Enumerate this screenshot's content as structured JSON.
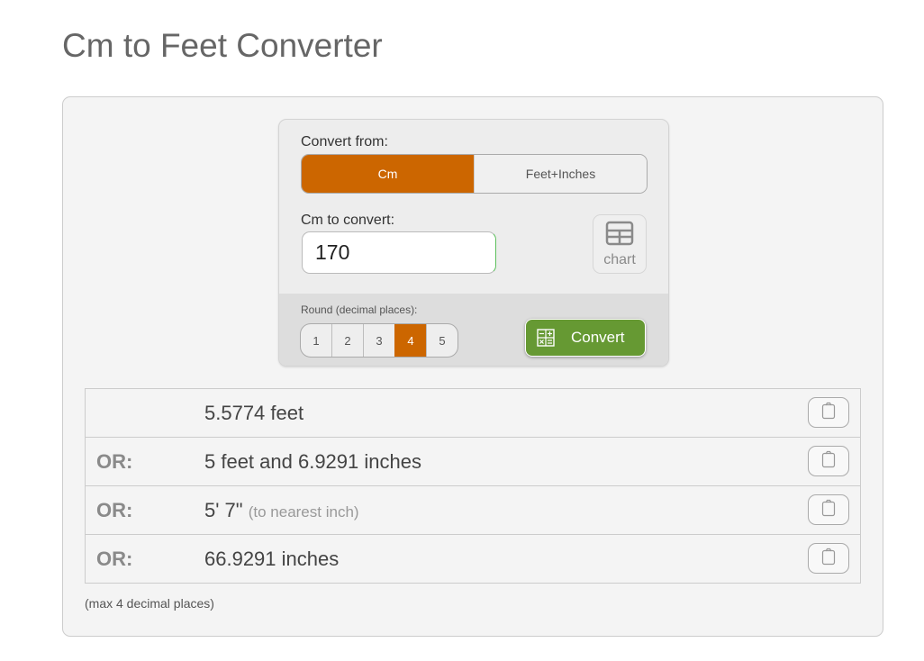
{
  "page": {
    "title": "Cm to Feet Converter"
  },
  "converter": {
    "convert_from_label": "Convert from:",
    "from_options": [
      {
        "label": "Cm",
        "active": true
      },
      {
        "label": "Feet+Inches",
        "active": false
      }
    ],
    "input_label": "Cm to convert:",
    "input_value": "170",
    "chart_button": {
      "icon": "table-icon",
      "label": "chart"
    },
    "round_label": "Round (decimal places):",
    "round_options": [
      "1",
      "2",
      "3",
      "4",
      "5"
    ],
    "round_selected": "4",
    "convert_button": {
      "icon": "calculator-icon",
      "label": "Convert"
    },
    "accent_color": "#cc6600",
    "convert_color": "#669933"
  },
  "results": {
    "rows": [
      {
        "prefix": "",
        "value": "5.5774 feet",
        "note": ""
      },
      {
        "prefix": "OR:",
        "value": "5 feet and 6.9291 inches",
        "note": ""
      },
      {
        "prefix": "OR:",
        "value": "5' 7\"",
        "note": "(to nearest inch)"
      },
      {
        "prefix": "OR:",
        "value": "66.9291 inches",
        "note": ""
      }
    ],
    "copy_icon": "clipboard-icon",
    "footnote": "(max 4 decimal places)"
  }
}
